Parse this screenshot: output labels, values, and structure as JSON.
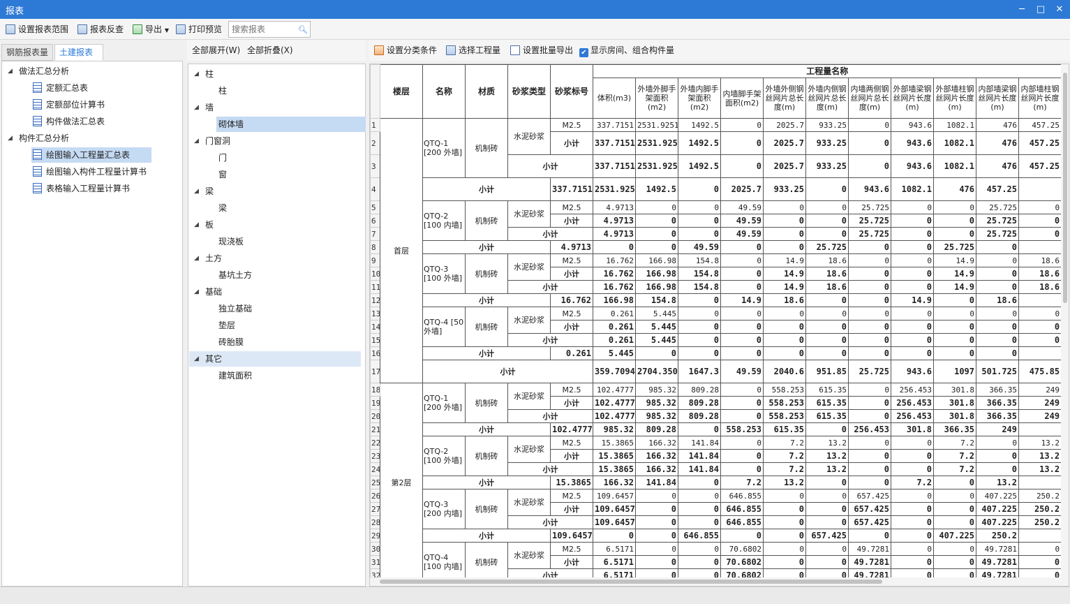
{
  "window": {
    "title": "报表"
  },
  "toolbar": {
    "set_range": "设置报表范围",
    "reverse": "报表反查",
    "export": "导出",
    "preview": "打印预览",
    "search_placeholder": "搜索报表"
  },
  "left_tabs": [
    "钢筋报表量",
    "土建报表量"
  ],
  "left_tree": {
    "g1": "做法汇总分析",
    "g1_items": [
      "定额汇总表",
      "定额部位计算书",
      "构件做法汇总表"
    ],
    "g2": "构件汇总分析",
    "g2_items": [
      "绘图输入工程量汇总表",
      "绘图输入构件工程量计算书",
      "表格输入工程量计算书"
    ]
  },
  "mid": {
    "expand_all": "全部展开(W)",
    "collapse_all": "全部折叠(X)",
    "tree": [
      {
        "label": "柱",
        "children": [
          "柱"
        ]
      },
      {
        "label": "墙",
        "children": [
          "砌体墙"
        ]
      },
      {
        "label": "门窗洞",
        "children": [
          "门",
          "窗"
        ]
      },
      {
        "label": "梁",
        "children": [
          "梁"
        ]
      },
      {
        "label": "板",
        "children": [
          "现浇板"
        ]
      },
      {
        "label": "土方",
        "children": [
          "基坑土方"
        ]
      },
      {
        "label": "基础",
        "children": [
          "独立基础",
          "垫层",
          "砖胎膜"
        ]
      },
      {
        "label": "其它",
        "children": [
          "建筑面积"
        ]
      }
    ]
  },
  "right_toolbar": {
    "set_cond": "设置分类条件",
    "select_qty": "选择工程量",
    "batch_export": "设置批量导出",
    "show_room": "显示房间、组合构件量"
  },
  "grid": {
    "group_header": "工程量名称",
    "headers": [
      "楼层",
      "名称",
      "材质",
      "砂浆类型",
      "砂浆标号",
      "体积(m3)",
      "外墙外脚手架面积(m2)",
      "外墙内脚手架面积(m2)",
      "内墙脚手架面积(m2)",
      "外墙外侧钢丝网片总长度(m)",
      "外墙内侧钢丝网片总长度(m)",
      "内墙两侧钢丝网片总长度(m)",
      "外部墙梁钢丝网片长度(m)",
      "外部墙柱钢丝网片长度(m)",
      "内部墙梁钢丝网片长度(m)",
      "内部墙柱钢丝网片长度(m)"
    ],
    "subtotal": "小计",
    "mortar_type": "水泥砂浆",
    "mortar_grade": "M2.5",
    "material": "机制砖",
    "floors": [
      "首层",
      "第2层"
    ],
    "names": [
      "QTQ-1 [200 外墙]",
      "QTQ-2 [100 内墙]",
      "QTQ-3 [100 外墙]",
      "QTQ-4 [50 外墙]",
      "QTQ-1 [200 外墙]",
      "QTQ-2 [100 外墙]",
      "QTQ-3 [200 内墙]",
      "QTQ-4 [100 内墙]"
    ],
    "rows": [
      [
        "337.7151",
        "2531.9251",
        "1492.5",
        "0",
        "2025.7",
        "933.25",
        "0",
        "943.6",
        "1082.1",
        "476",
        "457.25"
      ],
      [
        "337.7151",
        "2531.9251",
        "1492.5",
        "0",
        "2025.7",
        "933.25",
        "0",
        "943.6",
        "1082.1",
        "476",
        "457.25"
      ],
      [
        "337.7151",
        "2531.9251",
        "1492.5",
        "0",
        "2025.7",
        "933.25",
        "0",
        "943.6",
        "1082.1",
        "476",
        "457.25"
      ],
      [
        "337.7151",
        "2531.9251",
        "1492.5",
        "0",
        "2025.7",
        "933.25",
        "0",
        "943.6",
        "1082.1",
        "476",
        "457.25"
      ],
      [
        "4.9713",
        "0",
        "0",
        "49.59",
        "0",
        "0",
        "25.725",
        "0",
        "0",
        "25.725",
        "0"
      ],
      [
        "4.9713",
        "0",
        "0",
        "49.59",
        "0",
        "0",
        "25.725",
        "0",
        "0",
        "25.725",
        "0"
      ],
      [
        "4.9713",
        "0",
        "0",
        "49.59",
        "0",
        "0",
        "25.725",
        "0",
        "0",
        "25.725",
        "0"
      ],
      [
        "4.9713",
        "0",
        "0",
        "49.59",
        "0",
        "0",
        "25.725",
        "0",
        "0",
        "25.725",
        "0"
      ],
      [
        "16.762",
        "166.98",
        "154.8",
        "0",
        "14.9",
        "18.6",
        "0",
        "0",
        "14.9",
        "0",
        "18.6"
      ],
      [
        "16.762",
        "166.98",
        "154.8",
        "0",
        "14.9",
        "18.6",
        "0",
        "0",
        "14.9",
        "0",
        "18.6"
      ],
      [
        "16.762",
        "166.98",
        "154.8",
        "0",
        "14.9",
        "18.6",
        "0",
        "0",
        "14.9",
        "0",
        "18.6"
      ],
      [
        "16.762",
        "166.98",
        "154.8",
        "0",
        "14.9",
        "18.6",
        "0",
        "0",
        "14.9",
        "0",
        "18.6"
      ],
      [
        "0.261",
        "5.445",
        "0",
        "0",
        "0",
        "0",
        "0",
        "0",
        "0",
        "0",
        "0"
      ],
      [
        "0.261",
        "5.445",
        "0",
        "0",
        "0",
        "0",
        "0",
        "0",
        "0",
        "0",
        "0"
      ],
      [
        "0.261",
        "5.445",
        "0",
        "0",
        "0",
        "0",
        "0",
        "0",
        "0",
        "0",
        "0"
      ],
      [
        "0.261",
        "5.445",
        "0",
        "0",
        "0",
        "0",
        "0",
        "0",
        "0",
        "0",
        "0"
      ],
      [
        "359.7094",
        "2704.3501",
        "1647.3",
        "49.59",
        "2040.6",
        "951.85",
        "25.725",
        "943.6",
        "1097",
        "501.725",
        "475.85"
      ],
      [
        "102.4777",
        "985.32",
        "809.28",
        "0",
        "558.253",
        "615.35",
        "0",
        "256.453",
        "301.8",
        "366.35",
        "249"
      ],
      [
        "102.4777",
        "985.32",
        "809.28",
        "0",
        "558.253",
        "615.35",
        "0",
        "256.453",
        "301.8",
        "366.35",
        "249"
      ],
      [
        "102.4777",
        "985.32",
        "809.28",
        "0",
        "558.253",
        "615.35",
        "0",
        "256.453",
        "301.8",
        "366.35",
        "249"
      ],
      [
        "102.4777",
        "985.32",
        "809.28",
        "0",
        "558.253",
        "615.35",
        "0",
        "256.453",
        "301.8",
        "366.35",
        "249"
      ],
      [
        "15.3865",
        "166.32",
        "141.84",
        "0",
        "7.2",
        "13.2",
        "0",
        "0",
        "7.2",
        "0",
        "13.2"
      ],
      [
        "15.3865",
        "166.32",
        "141.84",
        "0",
        "7.2",
        "13.2",
        "0",
        "0",
        "7.2",
        "0",
        "13.2"
      ],
      [
        "15.3865",
        "166.32",
        "141.84",
        "0",
        "7.2",
        "13.2",
        "0",
        "0",
        "7.2",
        "0",
        "13.2"
      ],
      [
        "15.3865",
        "166.32",
        "141.84",
        "0",
        "7.2",
        "13.2",
        "0",
        "0",
        "7.2",
        "0",
        "13.2"
      ],
      [
        "109.6457",
        "0",
        "0",
        "646.855",
        "0",
        "0",
        "657.425",
        "0",
        "0",
        "407.225",
        "250.2"
      ],
      [
        "109.6457",
        "0",
        "0",
        "646.855",
        "0",
        "0",
        "657.425",
        "0",
        "0",
        "407.225",
        "250.2"
      ],
      [
        "109.6457",
        "0",
        "0",
        "646.855",
        "0",
        "0",
        "657.425",
        "0",
        "0",
        "407.225",
        "250.2"
      ],
      [
        "109.6457",
        "0",
        "0",
        "646.855",
        "0",
        "0",
        "657.425",
        "0",
        "0",
        "407.225",
        "250.2"
      ],
      [
        "6.5171",
        "0",
        "0",
        "70.6802",
        "0",
        "0",
        "49.7281",
        "0",
        "0",
        "49.7281",
        "0"
      ],
      [
        "6.5171",
        "0",
        "0",
        "70.6802",
        "0",
        "0",
        "49.7281",
        "0",
        "0",
        "49.7281",
        "0"
      ],
      [
        "6.5171",
        "0",
        "0",
        "70.6802",
        "0",
        "0",
        "49.7281",
        "0",
        "0",
        "49.7281",
        "0"
      ]
    ]
  }
}
